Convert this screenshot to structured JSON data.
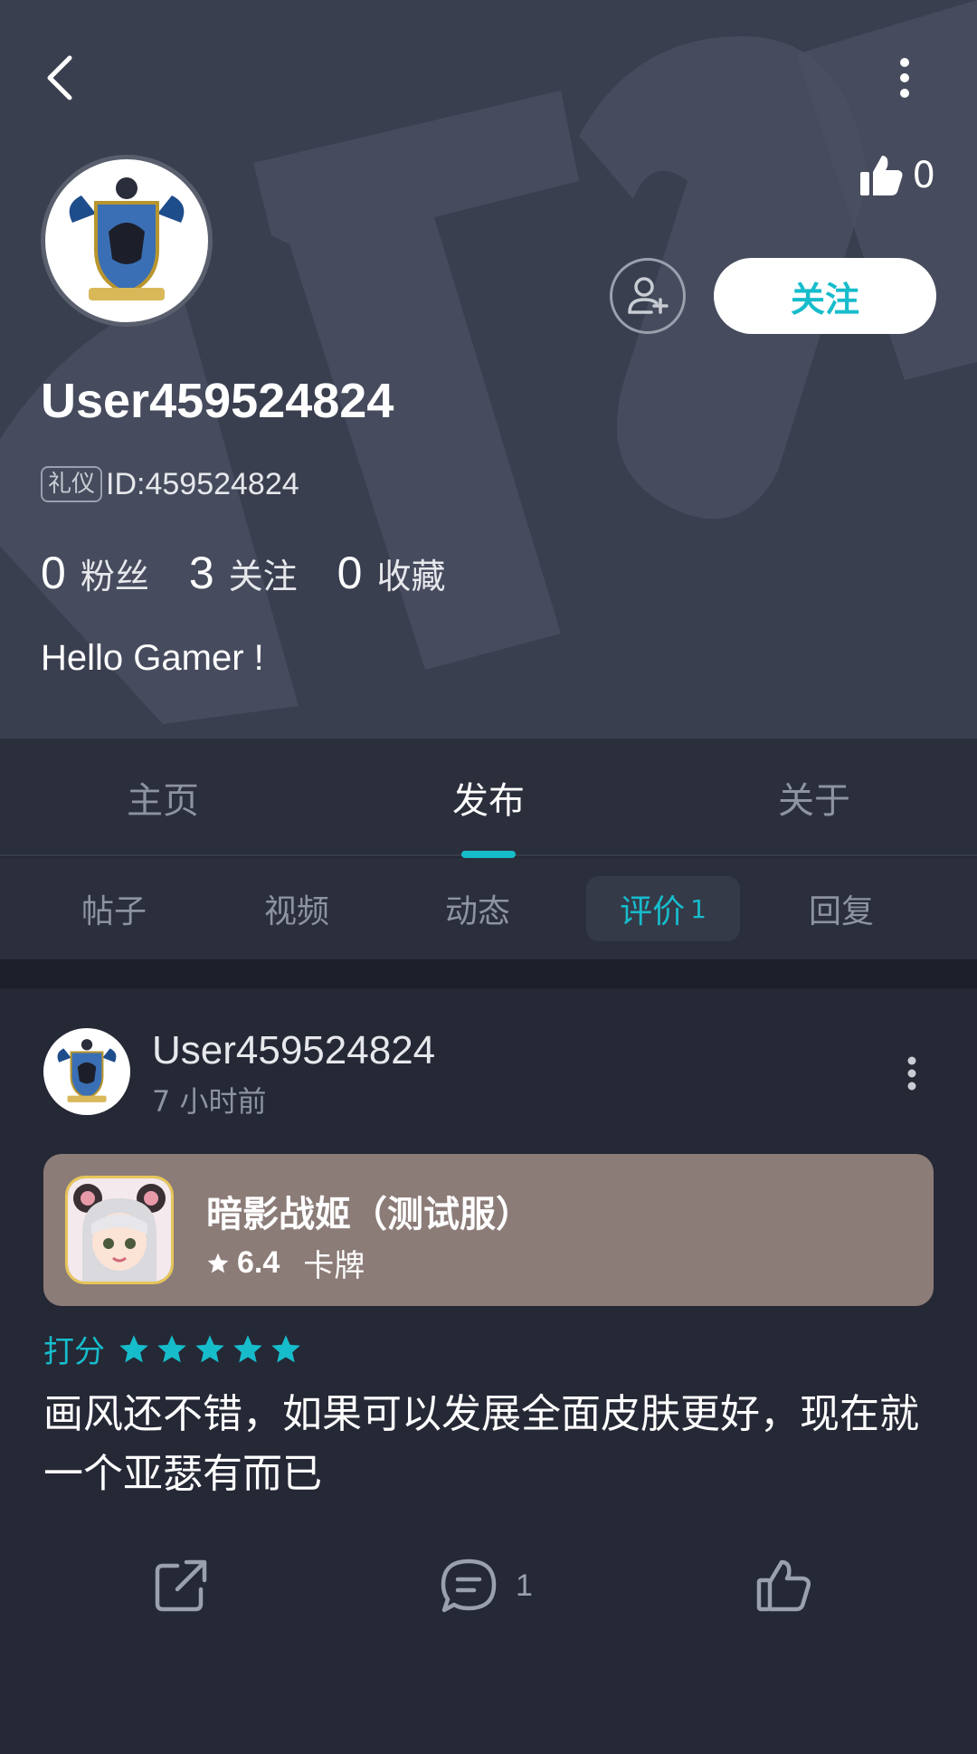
{
  "header": {
    "likes_count": "0",
    "follow_label": "关注"
  },
  "profile": {
    "username": "User459524824",
    "badge": "礼仪",
    "id_text": "ID:459524824",
    "stats": [
      {
        "num": "0",
        "label": "粉丝"
      },
      {
        "num": "3",
        "label": "关注"
      },
      {
        "num": "0",
        "label": "收藏"
      }
    ],
    "bio": "Hello Gamer !"
  },
  "main_tabs": [
    "主页",
    "发布",
    "关于"
  ],
  "main_tabs_active": "发布",
  "sub_tabs": [
    {
      "label": "帖子"
    },
    {
      "label": "视频"
    },
    {
      "label": "动态"
    },
    {
      "label": "评价",
      "count": "1"
    },
    {
      "label": "回复"
    }
  ],
  "post": {
    "author": "User459524824",
    "time": "7 小时前",
    "game": {
      "title": "暗影战姬（测试服）",
      "rating": "6.4",
      "genre": "卡牌"
    },
    "score_label": "打分",
    "stars": 5,
    "text": "画风还不错，如果可以发展全面皮肤更好，现在就一个亚瑟有而已",
    "comment_count": "1"
  },
  "colors": {
    "accent": "#17bccb",
    "header_bg": "#3a3f4f",
    "page_bg": "#252835",
    "card_bg": "#8c7c78"
  }
}
